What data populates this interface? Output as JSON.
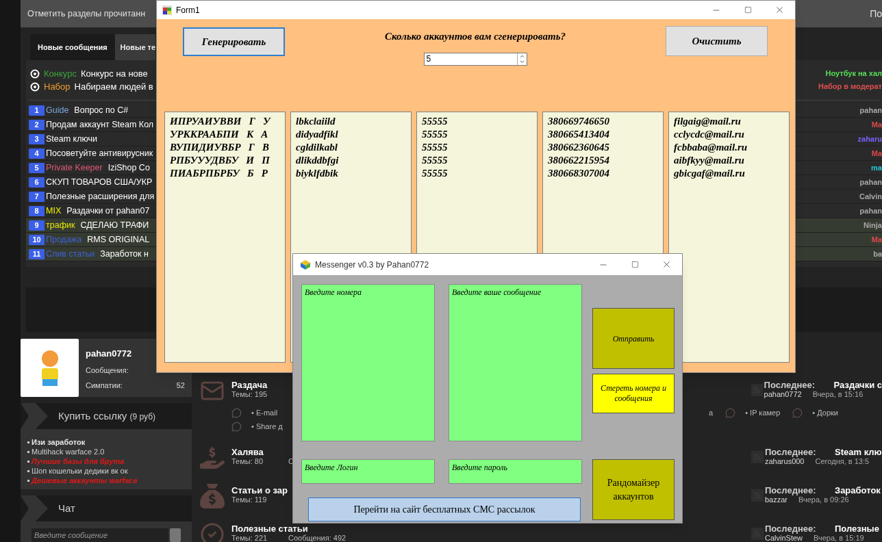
{
  "forum": {
    "top_bar": {
      "left": "Отметить разделы прочитанн",
      "right": "По"
    },
    "tabs": [
      {
        "label": "Новые сообщения",
        "selected": true
      },
      {
        "label": "Новые те",
        "selected": false
      }
    ],
    "announcements": [
      {
        "prefix": {
          "text": "Конкурс",
          "color": "#3fa33f"
        },
        "title": "Конкурс на нове",
        "right_link": {
          "text": "Ноутбук на хал",
          "color": "#55e055"
        }
      },
      {
        "prefix": {
          "text": "Набор",
          "color": "#f0a030"
        },
        "title": "Набираем людей в",
        "right_link": {
          "text": "Набор в модерат",
          "color": "#e05050"
        }
      }
    ],
    "threads": [
      {
        "number": "1",
        "prefix": {
          "text": "Guide",
          "color": "#79a9dc"
        },
        "title": "Вопрос по C#",
        "last_user": {
          "text": "pahan",
          "color": "#a8a8a8"
        },
        "highlighted": false
      },
      {
        "number": "2",
        "title": "Продам аккаунт Steam Кол",
        "last_user": {
          "text": "Ma",
          "color": "#e04848"
        },
        "highlighted": false
      },
      {
        "number": "3",
        "title": "Steam ключи",
        "last_user": {
          "text": "zaharu",
          "color": "#7a62ff"
        },
        "highlighted": false
      },
      {
        "number": "4",
        "title": "Посоветуйте антивирусник",
        "last_user": {
          "text": "Ma",
          "color": "#e04848"
        },
        "highlighted": false
      },
      {
        "number": "5",
        "prefix": {
          "text": "Private Keeper",
          "color": "#e05a73"
        },
        "title": "IziShop Co",
        "last_user": {
          "text": "ma",
          "color": "#22c6d6"
        },
        "highlighted": false
      },
      {
        "number": "6",
        "title": "СКУП ТОВАРОВ США/УКР",
        "last_user": {
          "text": "pahan",
          "color": "#a8a8a8"
        },
        "highlighted": false
      },
      {
        "number": "7",
        "title": "Полезные расширения для",
        "last_user": {
          "text": "Calvin",
          "color": "#a8a8a8"
        },
        "highlighted": false
      },
      {
        "number": "8",
        "prefix": {
          "text": "MIX",
          "color": "#f4f400"
        },
        "title": "Раздачки от pahan07",
        "last_user": {
          "text": "pahan",
          "color": "#a8a8a8"
        },
        "highlighted": false
      },
      {
        "number": "9",
        "prefix": {
          "text": "трафик",
          "color": "#e8e800"
        },
        "title": "СДЕЛАЮ ТРАФИ",
        "last_user": {
          "text": "Ninja",
          "color": "#a8a8a8"
        },
        "highlighted": true
      },
      {
        "number": "10",
        "prefix": {
          "text": "Продажа",
          "color": "#3e63d8"
        },
        "title": "RMS ORIGINAL",
        "last_user": {
          "text": "Ma",
          "color": "#e04848"
        },
        "highlighted": true
      },
      {
        "number": "11",
        "prefix": {
          "text": "Слив статьи",
          "color": "#3e63d8"
        },
        "title": "Заработок н",
        "last_user": {
          "text": "ba",
          "color": "#a8a8a8"
        },
        "highlighted": true
      }
    ],
    "profile": {
      "username": "pahan0772",
      "stats": [
        {
          "label": "Сообщения:"
        },
        {
          "label": "Симпатии:",
          "value": "52"
        }
      ]
    },
    "buy_links": {
      "title": "Купить ссылку",
      "price": "(9 руб)",
      "items": [
        {
          "text": "Изи заработок",
          "kind": "bold"
        },
        {
          "text": "Multihack warface 2.0",
          "kind": "plain"
        },
        {
          "text": "Лучшие базы для брута",
          "kind": "hot"
        },
        {
          "text": "Шоп кошельки дедики вк ок",
          "kind": "plain"
        },
        {
          "text": "Дешевые аккаунты warface",
          "kind": "hot"
        }
      ]
    },
    "chat": {
      "title": "Чат",
      "placeholder": "Введите сообщение"
    },
    "nodes": [
      {
        "title": "Раздача",
        "stats": [
          "Темы: 195"
        ],
        "subforums_left": [
          "• E-mail",
          "• Share д"
        ],
        "subforums_right": [
          {
            "text": "а",
            "icon": false
          },
          {
            "text": "• IP камер",
            "icon": true
          },
          {
            "text": "• Дорки",
            "icon": true
          }
        ],
        "last_post": {
          "label": "Последнее:",
          "thread": "Раздачки с",
          "user": "pahan0772",
          "time": "Вчера, в 15:16"
        }
      },
      {
        "title": "Халява",
        "stats": [
          "Темы: 80",
          "С"
        ],
        "last_post": {
          "label": "Последнее:",
          "thread": "Steam клю",
          "user": "zaharus000",
          "time": "Сегодня, в 13:5"
        }
      },
      {
        "title": "Статьи о зар",
        "stats": [
          "Темы: 119"
        ],
        "last_post": {
          "label": "Последнее:",
          "thread": "Заработок",
          "user": "bazzar",
          "time": "Вчера, в 09:26"
        }
      },
      {
        "title": "Полезные статьи",
        "stats": [
          "Темы: 221",
          "Сообщения: 492"
        ],
        "last_post": {
          "label": "Последнее:",
          "thread": "Полезные",
          "user": "CalvinStew",
          "time": "Вчера, в 15:19"
        }
      }
    ]
  },
  "form1": {
    "title": "Form1",
    "generate_button": "Генерировать",
    "prompt": "Сколько аккаунтов вам сгенерировать?",
    "count": "5",
    "clear_button": "Очистить",
    "columns": [
      [
        "ИПРУАИУВВИ   Г   У",
        "УРККРААБПИ   К   А",
        "ВУПИДИУВБР   Г   В",
        "РПБУУУДВБУ   И   П",
        "ПИАБРПБРБУ   Б   Р"
      ],
      [
        "lbkclaiild",
        "didyadfikl",
        "cgldilkabl",
        "dlikddbfgi",
        "biyklfdbik"
      ],
      [
        "55555",
        "55555",
        "55555",
        "55555",
        "55555"
      ],
      [
        "380669746650",
        "380665413404",
        "380662360645",
        "380662215954",
        "380668307004"
      ],
      [
        "filgaig@mail.ru",
        "cclycdc@mail.ru",
        "fcbbaba@mail.ru",
        "aibfkyy@mail.ru",
        "gbicgaf@mail.ru"
      ]
    ]
  },
  "messenger": {
    "title": "Messenger v0.3 by Pahan0772",
    "numbers_placeholder": "Введите номера",
    "message_placeholder": "Введите ваше сообщение",
    "send_button": "Отправить",
    "clear_button": "Стереть номера и  сообщения",
    "login_placeholder": "Введите Логин",
    "password_placeholder": "Введите пароль",
    "randomizer_button": "Рандомайзер аккаунтов",
    "sms_link_button": "Перейти на сайт бесплатных СМС рассылок"
  }
}
